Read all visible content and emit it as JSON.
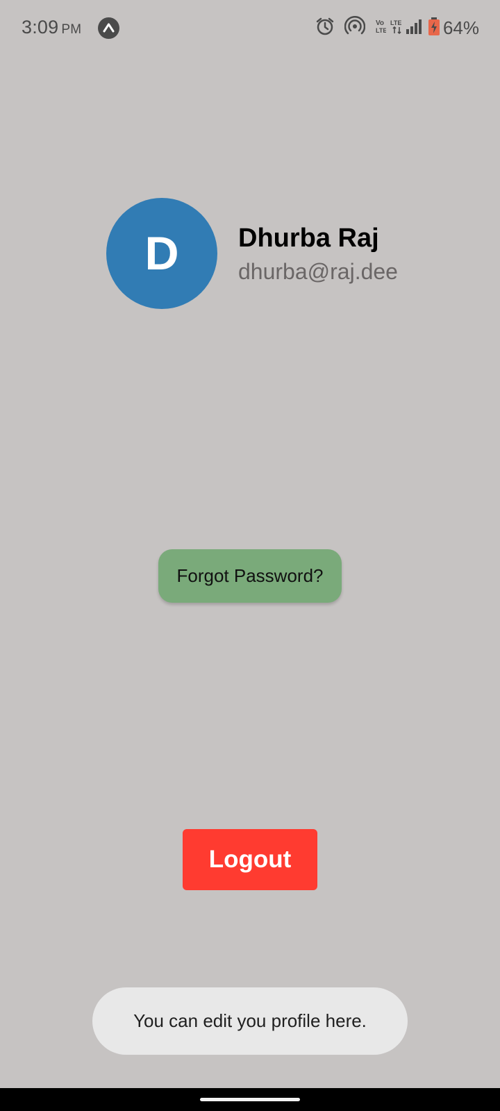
{
  "status_bar": {
    "time": "3:09",
    "ampm": "PM",
    "app_badge_icon": "expo-logo-icon",
    "icons": [
      "alarm-icon",
      "hotspot-icon",
      "volte-icon",
      "lte-icon",
      "signal-icon",
      "battery-charging-icon"
    ],
    "battery_percent": "64%"
  },
  "profile": {
    "avatar_initial": "D",
    "avatar_color": "#317cb4",
    "name": "Dhurba Raj",
    "email": "dhurba@raj.dee"
  },
  "actions": {
    "forgot_password_label": "Forgot Password?",
    "forgot_password_color": "#7aaa7a",
    "logout_label": "Logout",
    "logout_color": "#ff3b30"
  },
  "toast": {
    "message": "You can edit you profile here."
  },
  "colors": {
    "background": "#c6c3c2"
  }
}
